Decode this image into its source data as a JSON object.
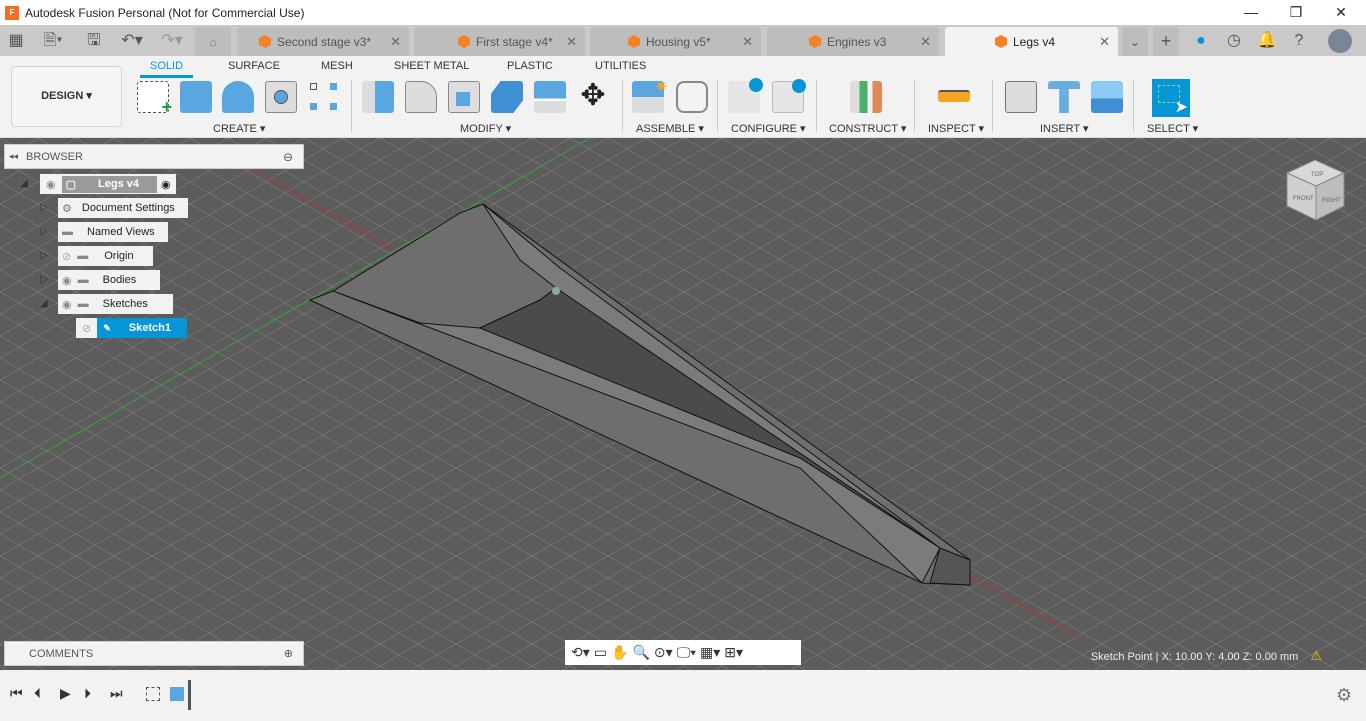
{
  "app": {
    "title": "Autodesk Fusion Personal (Not for Commercial Use)",
    "logo_text": "F"
  },
  "window_controls": {
    "minimize": "—",
    "maximize": "❐",
    "close": "✕"
  },
  "tabs": [
    {
      "label": "Second stage v3*",
      "active": false
    },
    {
      "label": "First stage v4*",
      "active": false
    },
    {
      "label": "Housing v5*",
      "active": false
    },
    {
      "label": "Engines v3",
      "active": false
    },
    {
      "label": "Legs v4",
      "active": true
    }
  ],
  "tab_close": "✕",
  "workspace": {
    "label": "DESIGN ▾"
  },
  "ribbon_tabs": [
    {
      "label": "SOLID",
      "active": true
    },
    {
      "label": "SURFACE"
    },
    {
      "label": "MESH"
    },
    {
      "label": "SHEET METAL"
    },
    {
      "label": "PLASTIC"
    },
    {
      "label": "UTILITIES"
    }
  ],
  "ribbon_groups": [
    {
      "label": "CREATE ▾"
    },
    {
      "label": "MODIFY ▾"
    },
    {
      "label": "ASSEMBLE ▾"
    },
    {
      "label": "CONFIGURE ▾"
    },
    {
      "label": "CONSTRUCT ▾"
    },
    {
      "label": "INSPECT ▾"
    },
    {
      "label": "INSERT ▾"
    },
    {
      "label": "SELECT ▾"
    }
  ],
  "browser": {
    "title": "BROWSER",
    "root": "Legs v4",
    "items": [
      {
        "label": "Document Settings"
      },
      {
        "label": "Named Views"
      },
      {
        "label": "Origin"
      },
      {
        "label": "Bodies"
      },
      {
        "label": "Sketches"
      },
      {
        "label": "Sketch1",
        "selected": true
      }
    ]
  },
  "comments": {
    "title": "COMMENTS"
  },
  "viewcube": {
    "top": "TOP",
    "front": "FRONT",
    "right": "RIGHT"
  },
  "status": {
    "text": "Sketch Point | X: 10.00 Y: 4.00 Z: 0.00 mm"
  },
  "colors": {
    "accent": "#0696d7",
    "viewport": "#5c5c5c",
    "tab_icon": "#f58220"
  }
}
